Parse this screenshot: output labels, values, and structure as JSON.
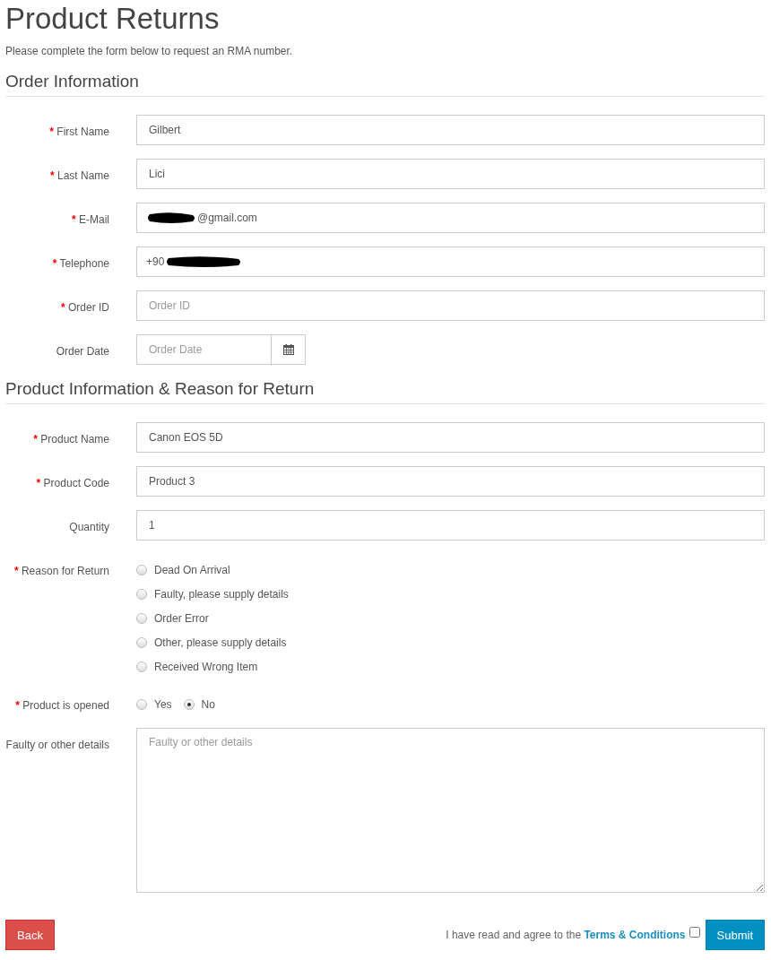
{
  "title": "Product Returns",
  "intro": "Please complete the form below to request an RMA number.",
  "sections": [
    {
      "heading": "Order Information",
      "fields": [
        {
          "kind": "text",
          "required": true,
          "label": "First Name",
          "value": "Gilbert"
        },
        {
          "kind": "text",
          "required": true,
          "label": "Last Name",
          "value": "Lici"
        },
        {
          "kind": "text",
          "required": true,
          "label": "E-Mail",
          "value_parts": [
            {
              "kind": "redacted"
            },
            {
              "kind": "text",
              "text": "@gmail.com"
            }
          ]
        },
        {
          "kind": "text",
          "required": true,
          "label": "Telephone",
          "value_parts": [
            {
              "kind": "text",
              "text": "+90"
            },
            {
              "kind": "redacted"
            }
          ]
        },
        {
          "kind": "text",
          "required": true,
          "label": "Order ID",
          "placeholder": "Order ID"
        },
        {
          "kind": "date",
          "required": false,
          "label": "Order Date",
          "placeholder": "Order Date"
        }
      ]
    },
    {
      "heading": "Product Information & Reason for Return",
      "fields": [
        {
          "kind": "text",
          "required": true,
          "label": "Product Name",
          "value": "Canon EOS 5D"
        },
        {
          "kind": "text",
          "required": true,
          "label": "Product Code",
          "value": "Product 3"
        },
        {
          "kind": "text",
          "required": false,
          "label": "Quantity",
          "value": "1"
        },
        {
          "kind": "radio-list",
          "required": true,
          "label": "Reason for Return",
          "options": [
            {
              "label": "Dead On Arrival",
              "selected": false
            },
            {
              "label": "Faulty, please supply details",
              "selected": false
            },
            {
              "label": "Order Error",
              "selected": false
            },
            {
              "label": "Other, please supply details",
              "selected": false
            },
            {
              "label": "Received Wrong Item",
              "selected": false
            }
          ]
        },
        {
          "kind": "radio-inline",
          "required": true,
          "label": "Product is opened",
          "options": [
            {
              "label": "Yes",
              "selected": false
            },
            {
              "label": "No",
              "selected": true
            }
          ]
        },
        {
          "kind": "textarea",
          "required": false,
          "label": "Faulty or other details",
          "placeholder": "Faulty or other details"
        }
      ]
    }
  ],
  "required_mark": "*",
  "footer": {
    "back": "Back",
    "agreement": "I have read and agree to the",
    "link": "Terms & Conditions",
    "agreed": false,
    "submit": "Submit"
  }
}
